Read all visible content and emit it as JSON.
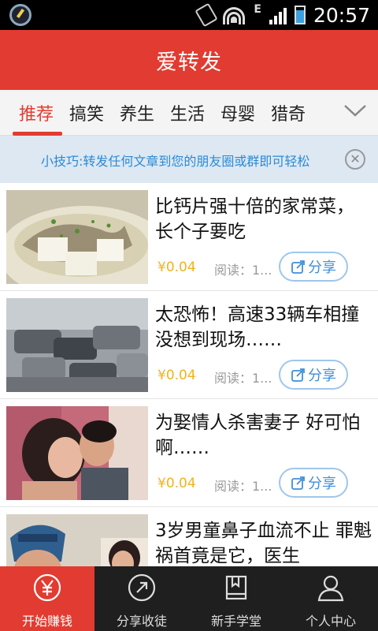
{
  "status_bar": {
    "time": "20:57",
    "network": "E"
  },
  "header": {
    "title": "爱转发"
  },
  "tabs": [
    {
      "label": "推荐",
      "active": true
    },
    {
      "label": "搞笑",
      "active": false
    },
    {
      "label": "养生",
      "active": false
    },
    {
      "label": "生活",
      "active": false
    },
    {
      "label": "母婴",
      "active": false
    },
    {
      "label": "猎奇",
      "active": false
    }
  ],
  "tip": {
    "text": "小技巧:转发任何文章到您的朋友圈或群即可轻松"
  },
  "articles": [
    {
      "title": "比钙片强十倍的家常菜，长个子要吃",
      "price": "¥0.04",
      "reads": "阅读：1...",
      "share_label": "分享",
      "thumb": "fish-tofu-soup"
    },
    {
      "title": "太恐怖！高速33辆车相撞 没想到现场……",
      "price": "¥0.04",
      "reads": "阅读：1...",
      "share_label": "分享",
      "thumb": "car-pileup"
    },
    {
      "title": "为娶情人杀害妻子 好可怕啊……",
      "price": "¥0.04",
      "reads": "阅读：1...",
      "share_label": "分享",
      "thumb": "couple"
    },
    {
      "title": "3岁男童鼻子血流不止 罪魁祸首竟是它，医生",
      "price": "",
      "reads": "",
      "share_label": "",
      "thumb": "doctor-child"
    }
  ],
  "bottom_nav": [
    {
      "label": "开始赚钱",
      "icon": "yen-circle-icon",
      "active": true
    },
    {
      "label": "分享收徒",
      "icon": "arrow-circle-icon",
      "active": false
    },
    {
      "label": "新手学堂",
      "icon": "book-icon",
      "active": false
    },
    {
      "label": "个人中心",
      "icon": "person-icon",
      "active": false
    }
  ],
  "colors": {
    "brand_red": "#e23b31",
    "link_blue": "#3f8fd9",
    "price_gold": "#f2b21e"
  }
}
